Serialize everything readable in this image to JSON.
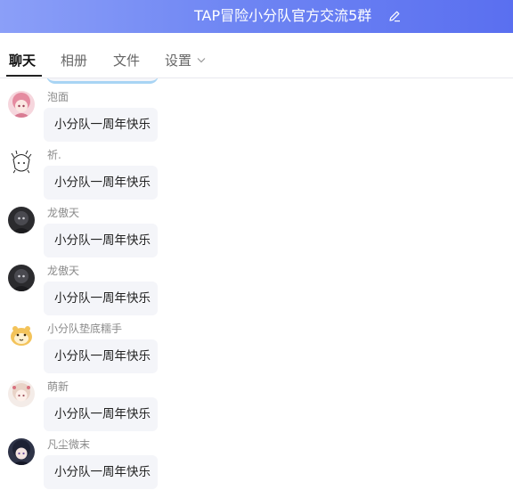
{
  "header": {
    "title": "TAP冒险小分队官方交流5群",
    "edit_icon": "edit-pencil-icon",
    "gradient": [
      "#8b9ff8",
      "#5a6ff0"
    ]
  },
  "tabs": [
    {
      "label": "聊天",
      "active": true
    },
    {
      "label": "相册",
      "active": false
    },
    {
      "label": "文件",
      "active": false
    },
    {
      "label": "设置",
      "active": false,
      "has_dropdown": true
    }
  ],
  "messages": [
    {
      "sender": "泡面",
      "text": "小分队一周年快乐",
      "avatar": "pink-hair-anime-girl"
    },
    {
      "sender": "祈.",
      "text": "小分队一周年快乐",
      "avatar": "sketch-anime-character"
    },
    {
      "sender": "龙傲天",
      "text": "小分队一周年快乐",
      "avatar": "dark-hooded-character"
    },
    {
      "sender": "龙傲天",
      "text": "小分队一周年快乐",
      "avatar": "dark-hooded-character"
    },
    {
      "sender": "小分队垫底糯手",
      "text": "小分队一周年快乐",
      "avatar": "hamster-mascot"
    },
    {
      "sender": "萌新",
      "text": "小分队一周年快乐",
      "avatar": "anime-girl-with-hairpins"
    },
    {
      "sender": "凡尘微末",
      "text": "小分队一周年快乐",
      "avatar": "dark-hair-anime-girl"
    }
  ]
}
